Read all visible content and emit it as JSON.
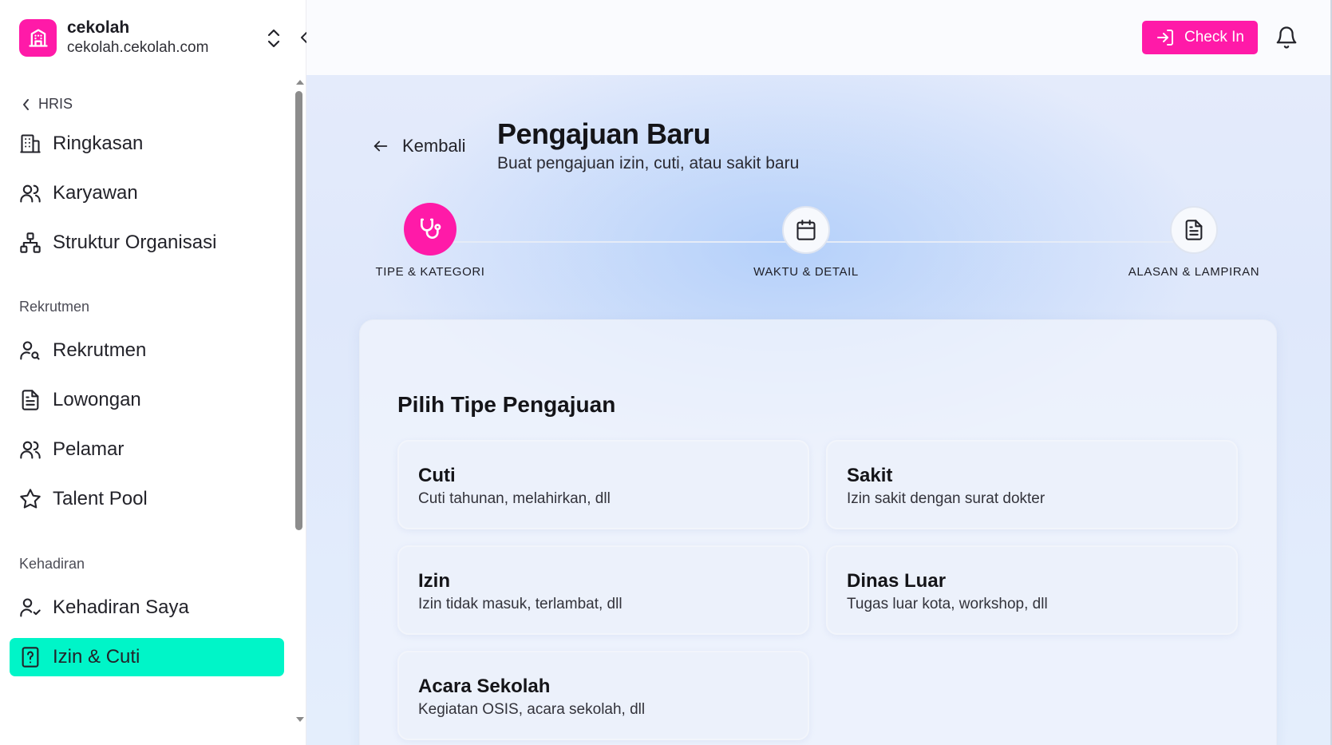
{
  "colors": {
    "accent": "#ff1aa8",
    "active_nav": "#00f5c8"
  },
  "org": {
    "name": "cekolah",
    "domain": "cekolah.cekolah.com"
  },
  "sidebar": {
    "back_label": "HRIS",
    "group1": [
      {
        "label": "Ringkasan",
        "icon": "building-icon"
      },
      {
        "label": "Karyawan",
        "icon": "users-icon"
      },
      {
        "label": "Struktur Organisasi",
        "icon": "org-chart-icon"
      }
    ],
    "section_rekrutmen": "Rekrutmen",
    "group2": [
      {
        "label": "Rekrutmen",
        "icon": "user-search-icon"
      },
      {
        "label": "Lowongan",
        "icon": "document-icon"
      },
      {
        "label": "Pelamar",
        "icon": "users-icon"
      },
      {
        "label": "Talent Pool",
        "icon": "star-icon"
      }
    ],
    "section_kehadiran": "Kehadiran",
    "group3": [
      {
        "label": "Kehadiran Saya",
        "icon": "user-check-icon"
      },
      {
        "label": "Izin & Cuti",
        "icon": "file-question-icon",
        "active": true
      }
    ]
  },
  "topbar": {
    "checkin_label": "Check In",
    "bell_icon": "bell-icon"
  },
  "page": {
    "back_label": "Kembali",
    "title": "Pengajuan Baru",
    "subtitle": "Buat pengajuan izin, cuti, atau sakit baru"
  },
  "stepper": {
    "steps": [
      {
        "label": "TIPE & KATEGORI",
        "icon": "stethoscope-icon",
        "active": true
      },
      {
        "label": "WAKTU & DETAIL",
        "icon": "calendar-icon",
        "active": false
      },
      {
        "label": "ALASAN & LAMPIRAN",
        "icon": "document-icon",
        "active": false
      }
    ]
  },
  "form": {
    "title": "Pilih Tipe Pengajuan",
    "options": [
      {
        "title": "Cuti",
        "desc": "Cuti tahunan, melahirkan, dll"
      },
      {
        "title": "Sakit",
        "desc": "Izin sakit dengan surat dokter"
      },
      {
        "title": "Izin",
        "desc": "Izin tidak masuk, terlambat, dll"
      },
      {
        "title": "Dinas Luar",
        "desc": "Tugas luar kota, workshop, dll"
      },
      {
        "title": "Acara Sekolah",
        "desc": "Kegiatan OSIS, acara sekolah, dll"
      }
    ]
  }
}
